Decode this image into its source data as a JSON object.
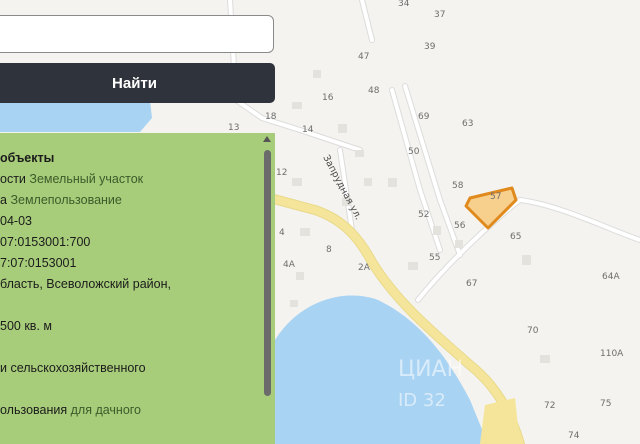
{
  "search": {
    "value": "",
    "placeholder": "",
    "button_label": "Найти"
  },
  "info": {
    "title": "объекты",
    "rows": [
      {
        "k": "ости ",
        "v": "Земельный участок"
      },
      {
        "k": "а ",
        "v": "Землепользование"
      },
      {
        "k": "04-03",
        "v": ""
      },
      {
        "k": "07:0153001:700",
        "v": ""
      },
      {
        "k": "7:07:0153001",
        "v": ""
      },
      {
        "k": "бласть, Всеволожский район,",
        "v": ""
      },
      {
        "k": "500 кв. м",
        "v": ""
      },
      {
        "k": "и сельскохозяйственного",
        "v": ""
      },
      {
        "k": "ользования ",
        "v": "для дачного"
      }
    ]
  },
  "map": {
    "street_name": "Запрудная ул.",
    "parcel_label": "57",
    "building_numbers": [
      "34",
      "37",
      "39",
      "47",
      "48",
      "16",
      "18",
      "14",
      "13",
      "69",
      "63",
      "50",
      "58",
      "12",
      "52",
      "56",
      "65",
      "4",
      "8",
      "55",
      "2А",
      "4А",
      "67",
      "64А",
      "70",
      "110А",
      "72",
      "75",
      "74"
    ],
    "watermark": "ЦИАН",
    "watermark_sub": "ID 32",
    "colors": {
      "water": "#a9d3f3",
      "main_road": "#f5e59a",
      "parcel_outline": "#e08a1e",
      "parcel_fill": "#f7d08e",
      "panel": "#a7cd7a",
      "button": "#2f333b"
    }
  }
}
